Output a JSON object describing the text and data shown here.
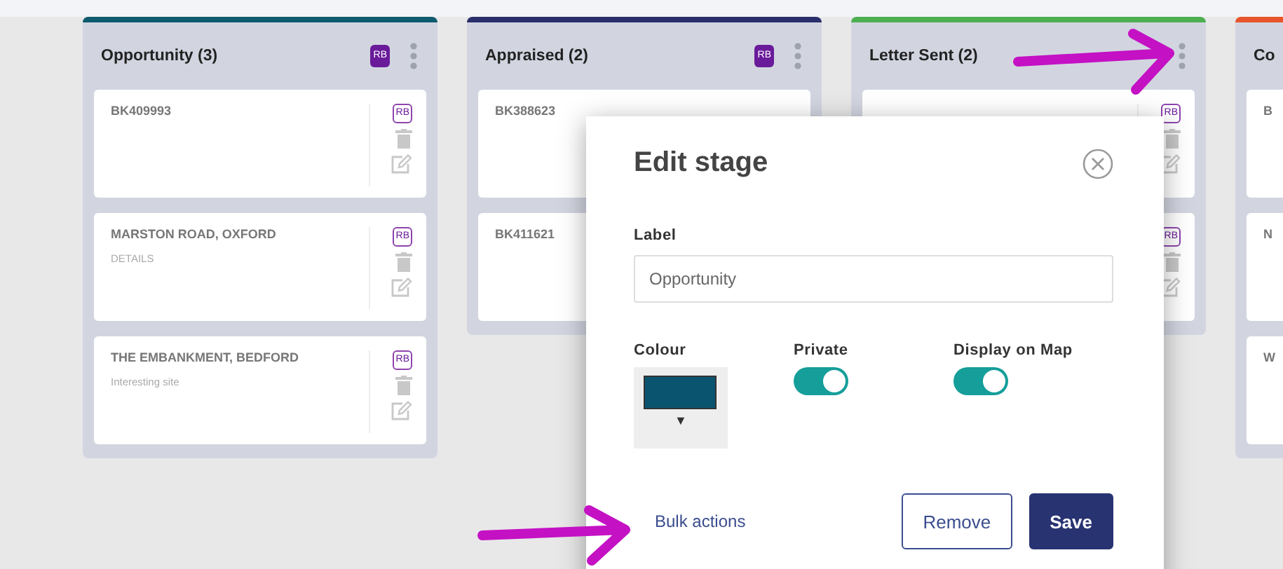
{
  "columns": [
    {
      "title": "Opportunity (3)",
      "color": "#0e5a6e",
      "badge": "RB",
      "cards": [
        {
          "title": "BK409993",
          "badge": "RB"
        },
        {
          "title": "MARSTON ROAD, OXFORD",
          "subtitle": "DETAILS",
          "badge": "RB"
        },
        {
          "title": "THE EMBANKMENT, BEDFORD",
          "subtitle": "Interesting site",
          "badge": "RB"
        }
      ]
    },
    {
      "title": "Appraised (2)",
      "color": "#2a2f6b",
      "badge": "RB",
      "cards": [
        {
          "title": "BK388623"
        },
        {
          "title": "BK411621"
        }
      ]
    },
    {
      "title": "Letter Sent (2)",
      "color": "#4caf50",
      "cards": [
        {
          "badge": "RB"
        },
        {
          "badge": "RB"
        }
      ]
    },
    {
      "title": "Co",
      "color": "#e8542c",
      "cards": [
        {
          "title": "B"
        },
        {
          "title": "N"
        },
        {
          "title": "W"
        }
      ]
    }
  ],
  "dialog": {
    "title": "Edit stage",
    "label_caption": "Label",
    "label_value": "Opportunity",
    "colour_caption": "Colour",
    "color": "#0b5470",
    "dropdown_glyph": "▼",
    "toggles": [
      {
        "label": "Private",
        "on": true
      },
      {
        "label": "Display on Map",
        "on": true
      }
    ],
    "bulk_link": "Bulk actions",
    "buttons": [
      {
        "label": "Remove",
        "kind": "outline"
      },
      {
        "label": "Save",
        "kind": "primary"
      }
    ]
  }
}
